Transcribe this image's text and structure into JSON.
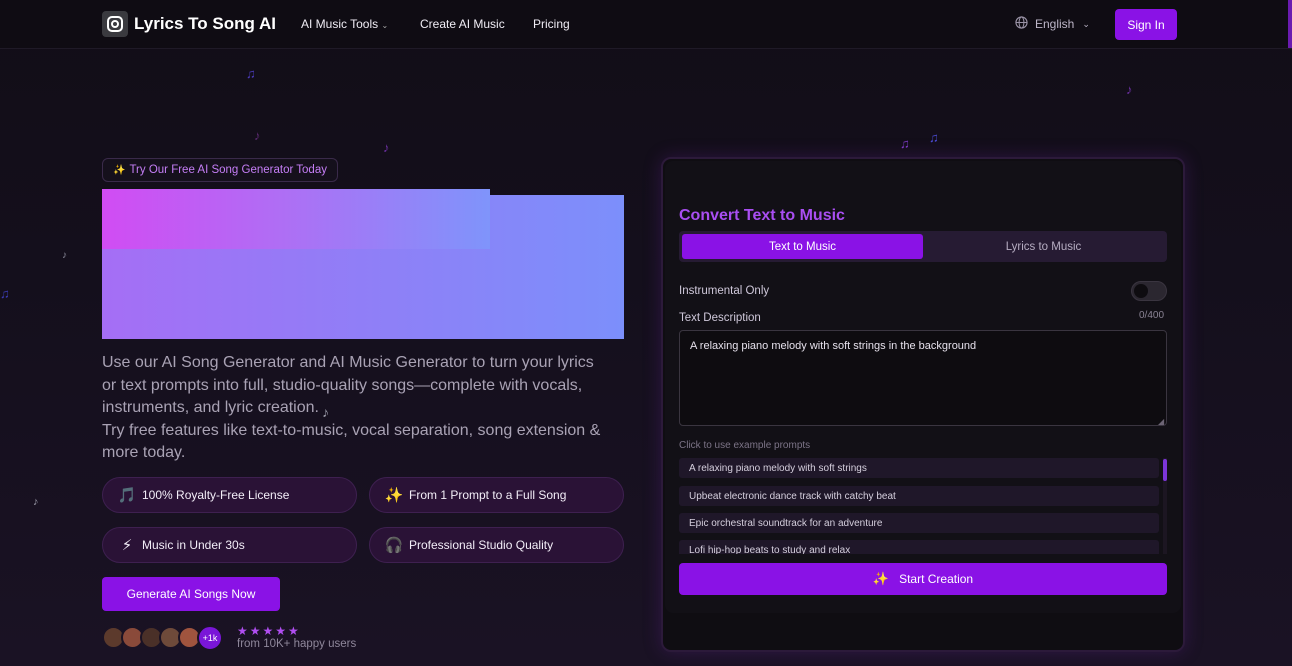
{
  "nav": {
    "logo_text": "Lyrics To Song AI",
    "tools_label": "AI Music Tools",
    "create_label": "Create AI Music",
    "pricing_label": "Pricing",
    "language": "English",
    "signin_label": "Sign In"
  },
  "hero": {
    "badge_text": "Try Our Free AI Song Generator Today",
    "description_1": "Use our AI Song Generator and AI Music Generator to turn your lyrics or text prompts into full, studio-quality songs—complete with vocals, instruments, and lyric creation.",
    "description_2": "Try free features like text-to-music, vocal separation, song extension & more today.",
    "features": [
      {
        "icon": "music-note-icon",
        "glyph": "🎵",
        "label": "100% Royalty-Free License"
      },
      {
        "icon": "sparkles-icon",
        "glyph": "✨",
        "label": "From 1 Prompt to a Full Song"
      },
      {
        "icon": "lightning-icon",
        "glyph": "⚡",
        "label": "Music in Under 30s"
      },
      {
        "icon": "headphones-icon",
        "glyph": "🎧",
        "label": "Professional Studio Quality"
      }
    ],
    "cta_label": "Generate AI Songs Now",
    "more_users_badge": "+1k",
    "stars": "★★★★★",
    "rating": 5,
    "users_text": "from 10K+ happy users"
  },
  "panel": {
    "title": "Convert Text to Music",
    "tabs": [
      {
        "label": "Text to Music",
        "active": true
      },
      {
        "label": "Lyrics to Music",
        "active": false
      }
    ],
    "instrumental_label": "Instrumental Only",
    "instrumental_on": false,
    "description_label": "Text Description",
    "char_counter": "0/400",
    "textarea_placeholder": "A relaxing piano melody with soft strings in the background",
    "examples_hint": "Click to use example prompts",
    "examples": [
      "A relaxing piano melody with soft strings",
      "Upbeat electronic dance track with catchy beat",
      "Epic orchestral soundtrack for an adventure",
      "Lofi hip-hop beats to study and relax"
    ],
    "start_label": "Start Creation"
  },
  "colors": {
    "accent": "#8a12e6",
    "title_purple": "#a94ef2",
    "background": "#140f1c"
  }
}
